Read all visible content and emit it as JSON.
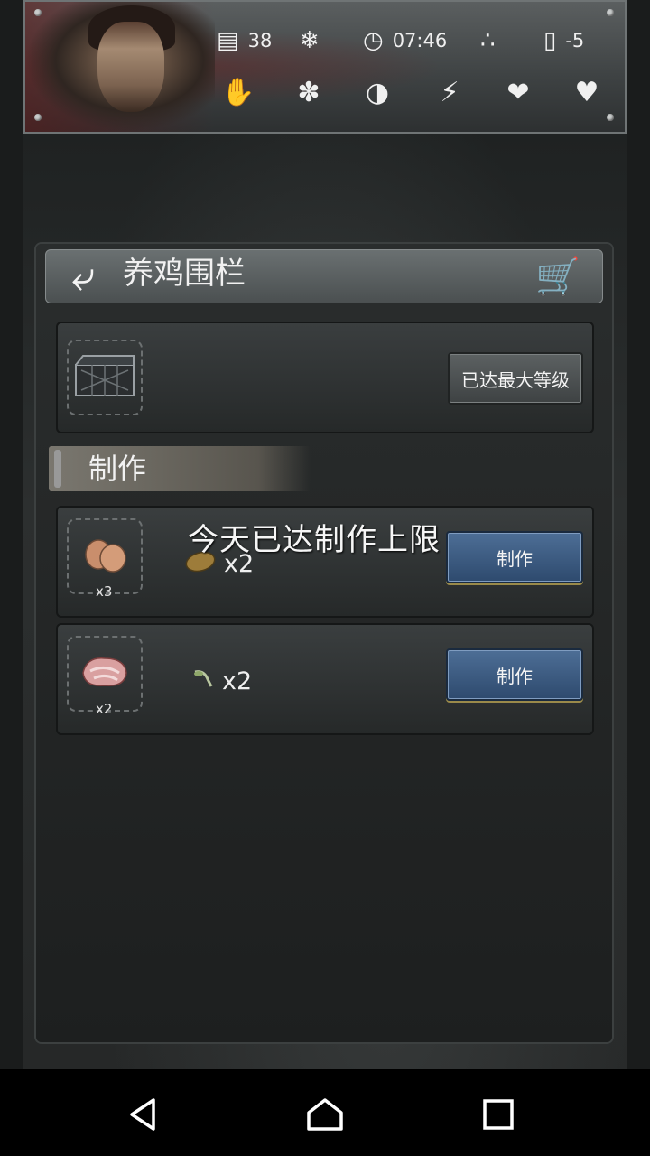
{
  "status": {
    "days": "38",
    "time": "07:46",
    "temperature": "-5",
    "icons": {
      "calendar": "calendar-icon",
      "snow": "snowflake-icon",
      "clock": "clock-icon",
      "weather": "snow-flakes-icon",
      "thermometer": "thermometer-icon"
    },
    "needs": [
      "hand-icon",
      "brain-icon",
      "stomach-icon",
      "energy-icon",
      "mood-icon",
      "heart-icon"
    ]
  },
  "header": {
    "title": "养鸡围栏",
    "back_icon": "back-arrow-icon",
    "cart_icon": "cart-icon"
  },
  "building": {
    "button_label": "已达最大等级"
  },
  "crafting": {
    "section_title": "制作",
    "limit_message": "今天已达制作上限",
    "recipes": [
      {
        "output_count": "x3",
        "output_icon": "eggs-icon",
        "ingredient_icon": "potato-icon",
        "ingredient_count": "x2",
        "button_label": "制作"
      },
      {
        "output_count": "x2",
        "output_icon": "meat-icon",
        "ingredient_icon": "herb-icon",
        "ingredient_count": "x2",
        "button_label": "制作"
      }
    ]
  },
  "navigation": {
    "back": "nav-back-icon",
    "home": "nav-home-icon",
    "recents": "nav-recents-icon"
  }
}
